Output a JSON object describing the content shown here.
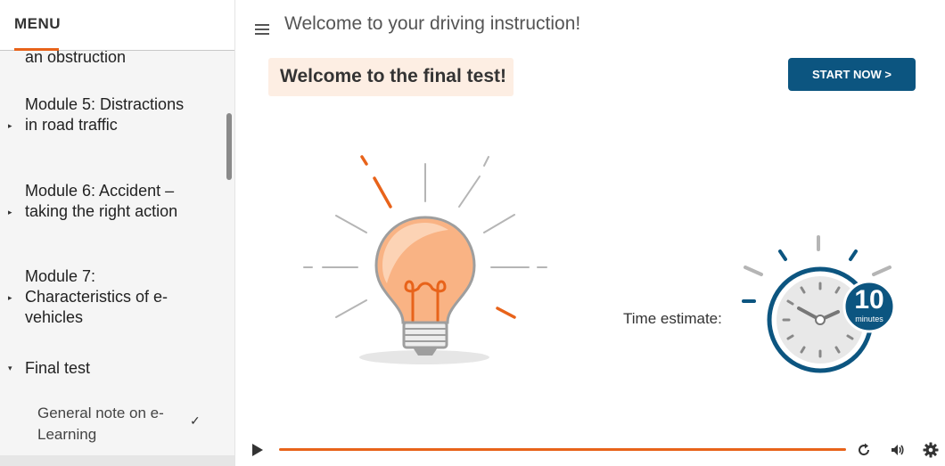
{
  "menu": {
    "title": "MENU",
    "cut_item": "an obstruction",
    "modules": [
      {
        "label": "Module 5: Distractions in road traffic",
        "expanded": false
      },
      {
        "label": "Module 6: Accident – taking the right action",
        "expanded": false
      },
      {
        "label": "Module 7: Characteristics of e-vehicles",
        "expanded": false
      },
      {
        "label": "Final test",
        "expanded": true
      }
    ],
    "sub_items": [
      {
        "label": "General note on e-Learning",
        "completed": true
      }
    ]
  },
  "header": {
    "title": "Welcome to your driving instruction!"
  },
  "main": {
    "welcome": "Welcome to the final test!",
    "start_button": "START NOW >",
    "time_label": "Time estimate:",
    "time_value": "10",
    "time_unit": "minutes"
  },
  "player": {
    "progress": 1.0
  },
  "colors": {
    "accent": "#e8631a",
    "brand": "#0c5580",
    "welcome_bg": "#fdeee3"
  }
}
